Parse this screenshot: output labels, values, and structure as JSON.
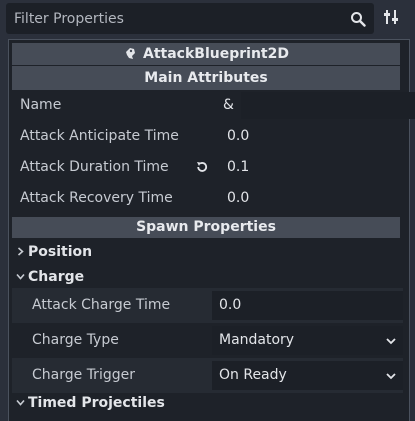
{
  "filter": {
    "placeholder": "Filter Properties"
  },
  "object": {
    "title": "AttackBlueprint2D"
  },
  "sections": {
    "main": "Main Attributes",
    "spawn": "Spawn Properties"
  },
  "main_rows": [
    {
      "label": "Name",
      "value": "&"
    },
    {
      "label": "Attack Anticipate Time",
      "value": "0.0"
    },
    {
      "label": "Attack Duration Time",
      "value": "0.1"
    },
    {
      "label": "Attack Recovery Time",
      "value": "0.0"
    }
  ],
  "groups": {
    "position": "Position",
    "charge": "Charge",
    "timed": "Timed Projectiles"
  },
  "charge_rows": [
    {
      "label": "Attack Charge Time",
      "value": "0.0"
    },
    {
      "label": "Charge Type",
      "value": "Mandatory"
    },
    {
      "label": "Charge Trigger",
      "value": "On Ready"
    }
  ],
  "colors": {
    "background": "#2b303b",
    "panel": "#1e2229",
    "header": "#464c57",
    "field": "#1c2027"
  }
}
